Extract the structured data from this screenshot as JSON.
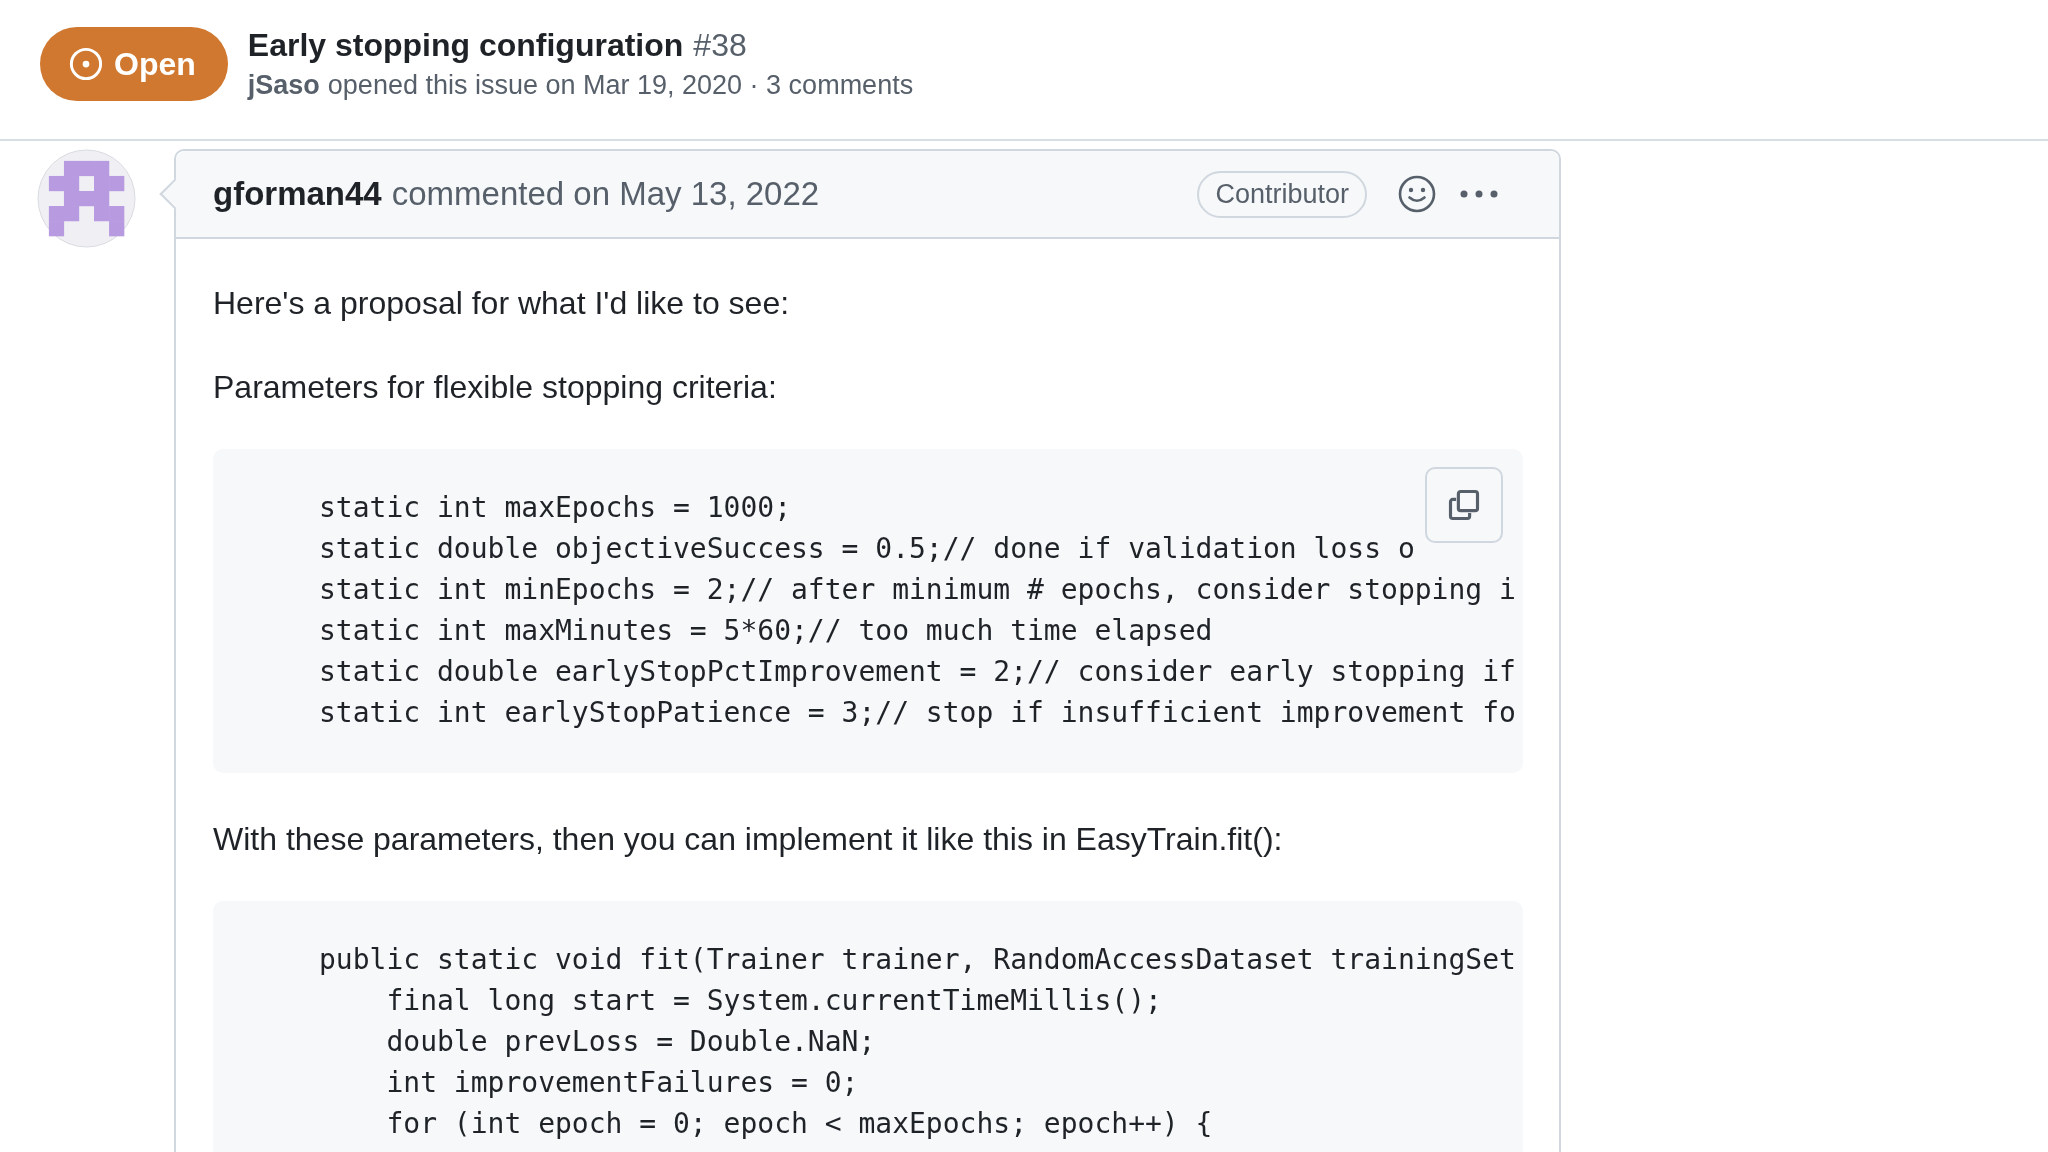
{
  "issue": {
    "state_label": "Open",
    "title": "Early stopping configuration",
    "number": "#38",
    "author": "jSaso",
    "meta": "opened this issue on Mar 19, 2020 · 3 comments"
  },
  "comment": {
    "author": "gforman44",
    "meta": "commented on May 13, 2022",
    "role": "Contributor",
    "body": [
      {
        "kind": "text",
        "text": "Here's a proposal for what I'd like to see:"
      },
      {
        "kind": "text",
        "text": "Parameters for flexible stopping criteria:"
      },
      {
        "kind": "code",
        "copy": true,
        "lines": [
          "static int maxEpochs = 1000;",
          "static double objectiveSuccess = 0.5;// done if validation loss o",
          "static int minEpochs = 2;// after minimum # epochs, consider stopping i",
          "static int maxMinutes = 5*60;// too much time elapsed",
          "static double earlyStopPctImprovement = 2;// consider early stopping if",
          "static int earlyStopPatience = 3;// stop if insufficient improvement fo"
        ]
      },
      {
        "kind": "text",
        "text": "With these parameters, then you can implement it like this in EasyTrain.fit():"
      },
      {
        "kind": "code",
        "copy": false,
        "lines": [
          "public static void fit(Trainer trainer, RandomAccessDataset trainingSet",
          "    final long start = System.currentTimeMillis();",
          "    double prevLoss = Double.NaN;",
          "    int improvementFailures = 0;",
          "    for (int epoch = 0; epoch < maxEpochs; epoch++) {"
        ]
      }
    ]
  }
}
